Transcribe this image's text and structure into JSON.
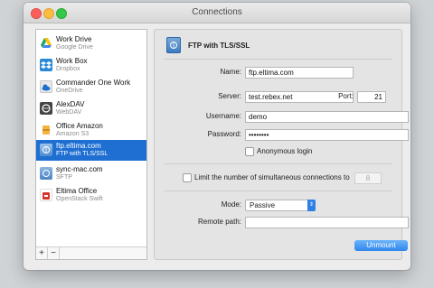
{
  "window": {
    "title": "Connections"
  },
  "sidebar": {
    "items": [
      {
        "name": "Work Drive",
        "type": "Google Drive",
        "icon": "google-drive-icon",
        "color": "#34a853"
      },
      {
        "name": "Work Box",
        "type": "Dropbox",
        "icon": "dropbox-icon",
        "color": "#2a8ad8"
      },
      {
        "name": "Commander One Work",
        "type": "OneDrive",
        "icon": "onedrive-icon",
        "color": "#e8e8e8"
      },
      {
        "name": "AlexDAV",
        "type": "WebDAV",
        "icon": "webdav-icon",
        "color": "#444444"
      },
      {
        "name": "Office Amazon",
        "type": "Amazon S3",
        "icon": "amazon-s3-icon",
        "color": "#f4b43c"
      },
      {
        "name": "ftp.eltima.com",
        "type": "FTP with TLS/SSL",
        "icon": "ftp-icon",
        "color": "#7aa9d9",
        "selected": true
      },
      {
        "name": "sync-mac.com",
        "type": "SFTP",
        "icon": "sftp-icon",
        "color": "#5a8ec8"
      },
      {
        "name": "Eltima Office",
        "type": "OpenStack Swift",
        "icon": "openstack-icon",
        "color": "#d9342b"
      }
    ],
    "add_label": "+",
    "remove_label": "−"
  },
  "panel": {
    "title": "FTP with TLS/SSL",
    "name_label": "Name:",
    "name_value": "ftp.eltima.com",
    "server_label": "Server:",
    "server_value": "test.rebex.net",
    "port_label": "Port:",
    "port_value": "21",
    "username_label": "Username:",
    "username_value": "demo",
    "password_label": "Password:",
    "password_value": "••••••••",
    "anonymous_label": "Anonymous login",
    "limit_label": "Limit the number of simultaneous connections to",
    "limit_value": "8",
    "mode_label": "Mode:",
    "mode_value": "Passive",
    "remote_label": "Remote path:",
    "remote_value": "",
    "unmount_label": "Unmount"
  }
}
